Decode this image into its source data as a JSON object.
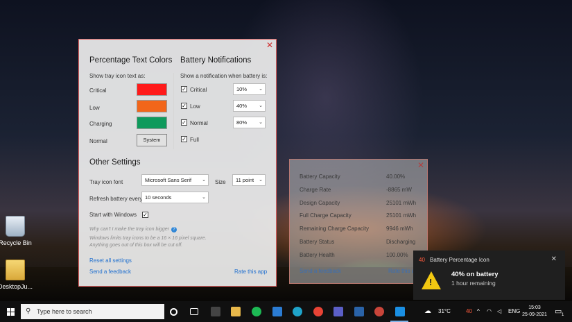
{
  "desktop": {
    "icons": [
      {
        "label": "Recycle Bin"
      },
      {
        "label": "DesktopJu..."
      }
    ]
  },
  "settings": {
    "close": "✕",
    "colors_title": "Percentage Text Colors",
    "colors_sub": "Show tray icon text as:",
    "color_rows": [
      {
        "label": "Critical",
        "color": "#ff1a1a"
      },
      {
        "label": "Low",
        "color": "#f2661a"
      },
      {
        "label": "Charging",
        "color": "#0e9a5c"
      }
    ],
    "normal_label": "Normal",
    "system_button": "System",
    "notif_title": "Battery Notifications",
    "notif_sub": "Show a notification when battery is:",
    "notif_rows": [
      {
        "label": "Critical",
        "checked": "✓",
        "value": "10%"
      },
      {
        "label": "Low",
        "checked": "✓",
        "value": "40%"
      },
      {
        "label": "Normal",
        "checked": "✓",
        "value": "80%"
      },
      {
        "label": "Full",
        "checked": "✓"
      }
    ],
    "other_title": "Other Settings",
    "font_label": "Tray icon font",
    "font_value": "Microsoft Sans Serif",
    "size_label": "Size",
    "size_value": "11 point",
    "refresh_label": "Refresh battery every",
    "refresh_value": "10 seconds",
    "start_label": "Start with Windows",
    "start_checked": "✓",
    "why_text": "Why can't I make the tray icon bigger",
    "why_note_1": "Windows limits tray icons to be a 16 × 16 pixel square.",
    "why_note_2": "Anything goes out of this box will be cut off.",
    "reset_link": "Reset all settings",
    "feedback_link": "Send a feedback",
    "rate_link": "Rate this app"
  },
  "info": {
    "close": "✕",
    "rows": [
      {
        "label": "Battery Capacity",
        "value": "40.00%"
      },
      {
        "label": "Charge Rate",
        "value": "-8865 mW"
      },
      {
        "label": "Design Capacity",
        "value": "25101 mWh"
      },
      {
        "label": "Full Charge Capacity",
        "value": "25101 mWh"
      },
      {
        "label": "Remaining Charge Capacity",
        "value": "9946 mWh"
      },
      {
        "label": "Battery Status",
        "value": "Discharging"
      },
      {
        "label": "Battery Health",
        "value": "100.00%"
      }
    ],
    "feedback_link": "Send a feedback",
    "rate_link": "Rate this app"
  },
  "toast": {
    "badge": "40",
    "app_name": "Battery Percentage Icon",
    "close": "✕",
    "title": "40% on battery",
    "body": "1 hour remaining"
  },
  "taskbar": {
    "search_placeholder": "Type here to search",
    "temperature": "31°C",
    "battery_text": "40",
    "language": "ENG",
    "time": "15:03",
    "date": "25-09-2021",
    "notification_count": "1"
  }
}
